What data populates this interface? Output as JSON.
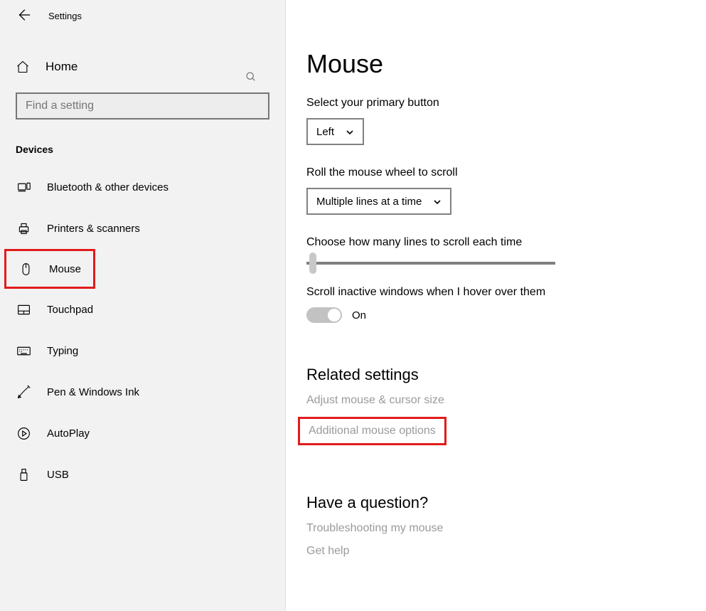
{
  "header": {
    "title": "Settings"
  },
  "sidebar": {
    "home_label": "Home",
    "search_placeholder": "Find a setting",
    "group_label": "Devices",
    "items": [
      {
        "label": "Bluetooth & other devices"
      },
      {
        "label": "Printers & scanners"
      },
      {
        "label": "Mouse"
      },
      {
        "label": "Touchpad"
      },
      {
        "label": "Typing"
      },
      {
        "label": "Pen & Windows Ink"
      },
      {
        "label": "AutoPlay"
      },
      {
        "label": "USB"
      }
    ]
  },
  "main": {
    "title": "Mouse",
    "primary_label": "Select your primary button",
    "primary_value": "Left",
    "wheel_label": "Roll the mouse wheel to scroll",
    "wheel_value": "Multiple lines at a time",
    "lines_label": "Choose how many lines to scroll each time",
    "inactive_label": "Scroll inactive windows when I hover over them",
    "inactive_value": "On",
    "related": {
      "title": "Related settings",
      "adjust": "Adjust mouse & cursor size",
      "additional": "Additional mouse options"
    },
    "help": {
      "title": "Have a question?",
      "troubleshoot": "Troubleshooting my mouse",
      "gethelp": "Get help"
    }
  }
}
